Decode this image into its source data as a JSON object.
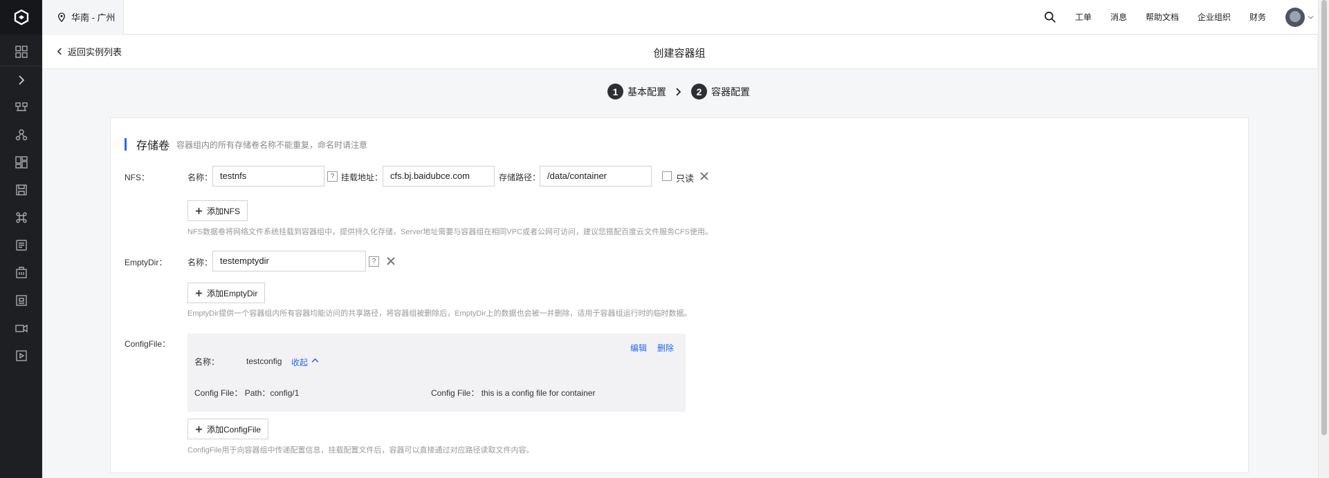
{
  "header": {
    "region": "华南 - 广州",
    "links": [
      "工单",
      "消息",
      "帮助文档",
      "企业组织",
      "财务"
    ]
  },
  "subbar": {
    "back_label": "返回实例列表",
    "title": "创建容器组"
  },
  "steps": [
    {
      "num": "1",
      "label": "基本配置"
    },
    {
      "num": "2",
      "label": "容器配置"
    }
  ],
  "section": {
    "title": "存储卷",
    "tip": "容器组内的所有存储卷名称不能重复，命名时请注意"
  },
  "nfs": {
    "label": "NFS：",
    "name_label": "名称：",
    "name_value": "testnfs",
    "addr_label": "挂载地址：",
    "addr_value": "cfs.bj.baidubce.com",
    "path_label": "存储路径：",
    "path_value": "/data/container",
    "readonly_label": "只读",
    "add_label": "添加NFS",
    "hint": "NFS数据卷将网络文件系统挂载到容器组中，提供持久化存储，Server地址需要与容器组在相同VPC或者公网可访问，建议您搭配百度云文件服务CFS使用。"
  },
  "emptydir": {
    "label": "EmptyDir：",
    "name_label": "名称：",
    "name_value": "testemptydir",
    "add_label": "添加EmptyDir",
    "hint": "EmptyDir提供一个容器组内所有容器均能访问的共享路径，将容器组被删除后，EmptyDir上的数据也会被一并删除，适用于容器组运行时的临时数据。"
  },
  "configfile": {
    "label": "ConfigFile：",
    "edit_label": "编辑",
    "delete_label": "删除",
    "name_label": "名称：",
    "name_value": "testconfig",
    "collapse_label": "收起",
    "path_text": "Config File： Path：config/1",
    "content_text": "Config File：  this is a config file for container",
    "add_label": "添加ConfigFile",
    "hint": "ConfigFile用于向容器组中传递配置信息，挂载配置文件后，容器可以直接通过对应路径读取文件内容。"
  },
  "sidebar": {
    "icons": [
      "grid-icon",
      "expand-icon",
      "cluster-icon",
      "network-icon",
      "dashboard-icon",
      "storage-icon",
      "command-icon",
      "config-icon",
      "building-icon",
      "registry-icon",
      "video-icon",
      "play-icon"
    ]
  }
}
